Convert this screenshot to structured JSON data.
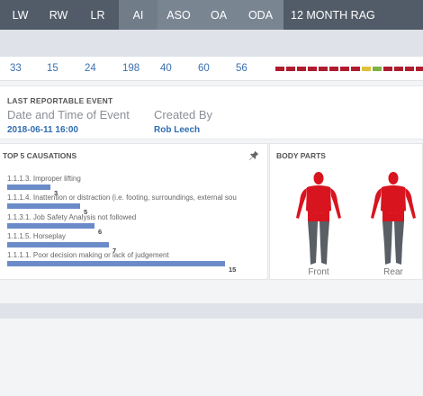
{
  "header": {
    "cols": [
      "LW",
      "RW",
      "LR",
      "AI",
      "ASO",
      "OA",
      "ODA"
    ],
    "rag_label": "12 MONTH RAG"
  },
  "metrics": [
    "33",
    "15",
    "24",
    "198",
    "40",
    "60",
    "56"
  ],
  "rag": {
    "segments": [
      "red",
      "red",
      "red",
      "red",
      "red",
      "red",
      "red",
      "red",
      "yellow",
      "green",
      "red",
      "red",
      "red",
      "red"
    ],
    "colors": {
      "red": "#b01c2e",
      "yellow": "#e0c238",
      "green": "#7cb342"
    }
  },
  "last_event": {
    "title": "LAST REPORTABLE EVENT",
    "date_label": "Date and Time of Event",
    "date_value": "2018-06-11 16:00",
    "created_label": "Created By",
    "created_value": "Rob Leech"
  },
  "causations": {
    "title": "TOP 5 CAUSATIONS",
    "max": 15,
    "items": [
      {
        "label": "1.1.1.3. Improper lifting",
        "value": 3
      },
      {
        "label": "1.1.1.4. Inattention or distraction (i.e. footing, surroundings, external sou",
        "value": 5
      },
      {
        "label": "1.1.3.1. Job Safety Analysis not followed",
        "value": 6
      },
      {
        "label": "1.1.1.5. Horseplay",
        "value": 7
      },
      {
        "label": "1.1.1.1. Poor decision making or lack of judgement",
        "value": 15
      }
    ]
  },
  "body_parts": {
    "title": "BODY PARTS",
    "front_label": "Front",
    "rear_label": "Rear",
    "highlight_color": "#d8141e",
    "base_color": "#5a5f66"
  }
}
